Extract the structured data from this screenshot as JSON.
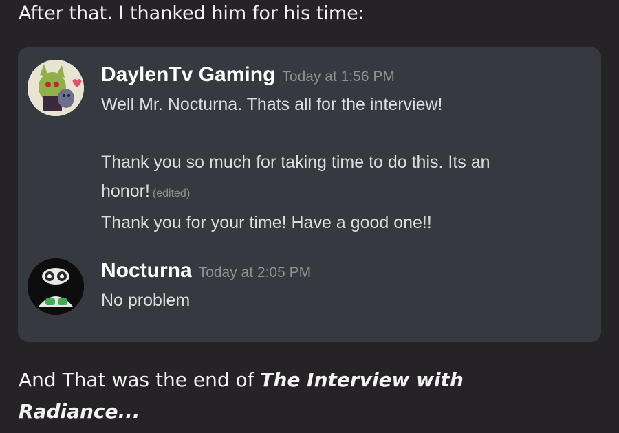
{
  "intro": "After that. I thanked him for his time:",
  "messages": [
    {
      "username": "DaylenTv Gaming",
      "timestamp": "Today at 1:56 PM",
      "lines": [
        "Well Mr. Nocturna. Thats all for the interview!",
        "",
        "Thank you so much for taking time to do this. Its an",
        "honor!",
        "Thank you for your time! Have a good one!!"
      ],
      "edited_label": "(edited)"
    },
    {
      "username": "Nocturna",
      "timestamp": "Today at 2:05 PM",
      "lines": [
        "No problem"
      ]
    }
  ],
  "outro": {
    "prefix": "And That was the end of ",
    "bold_1": "The Interview with",
    "bold_2": "Radiance..."
  },
  "colors": {
    "background": "#262326",
    "card": "#36393f",
    "username": "#ffffff",
    "message_text": "#dcddde",
    "timestamp": "#8e9297"
  }
}
